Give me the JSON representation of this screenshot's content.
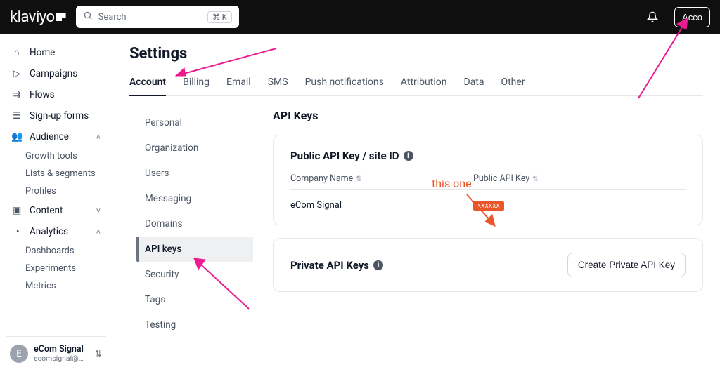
{
  "brand": "klaviyo",
  "search": {
    "placeholder": "Search",
    "kbd": "⌘ K"
  },
  "top_account_btn": "Acco",
  "sidebar": {
    "items": [
      {
        "label": "Home"
      },
      {
        "label": "Campaigns"
      },
      {
        "label": "Flows"
      },
      {
        "label": "Sign-up forms"
      },
      {
        "label": "Audience",
        "expanded": true,
        "sub": [
          "Growth tools",
          "Lists & segments",
          "Profiles"
        ]
      },
      {
        "label": "Content",
        "expanded": false
      },
      {
        "label": "Analytics",
        "expanded": true,
        "sub": [
          "Dashboards",
          "Experiments",
          "Metrics"
        ]
      }
    ],
    "account": {
      "initial": "E",
      "name": "eCom Signal",
      "email": "ecomsignal@…"
    }
  },
  "page_title": "Settings",
  "tabs": [
    "Account",
    "Billing",
    "Email",
    "SMS",
    "Push notifications",
    "Attribution",
    "Data",
    "Other"
  ],
  "subnav": [
    "Personal",
    "Organization",
    "Users",
    "Messaging",
    "Domains",
    "API keys",
    "Security",
    "Tags",
    "Testing"
  ],
  "subnav_active": "API keys",
  "panel_title": "API Keys",
  "public_card": {
    "title": "Public API Key / site ID",
    "col1": "Company Name",
    "col2": "Public API Key",
    "row_company": "eCom Signal",
    "row_key_masked": "XXXXXX"
  },
  "private_card": {
    "title": "Private API Keys",
    "create_btn": "Create Private API Key"
  },
  "annotation_text": "this one"
}
